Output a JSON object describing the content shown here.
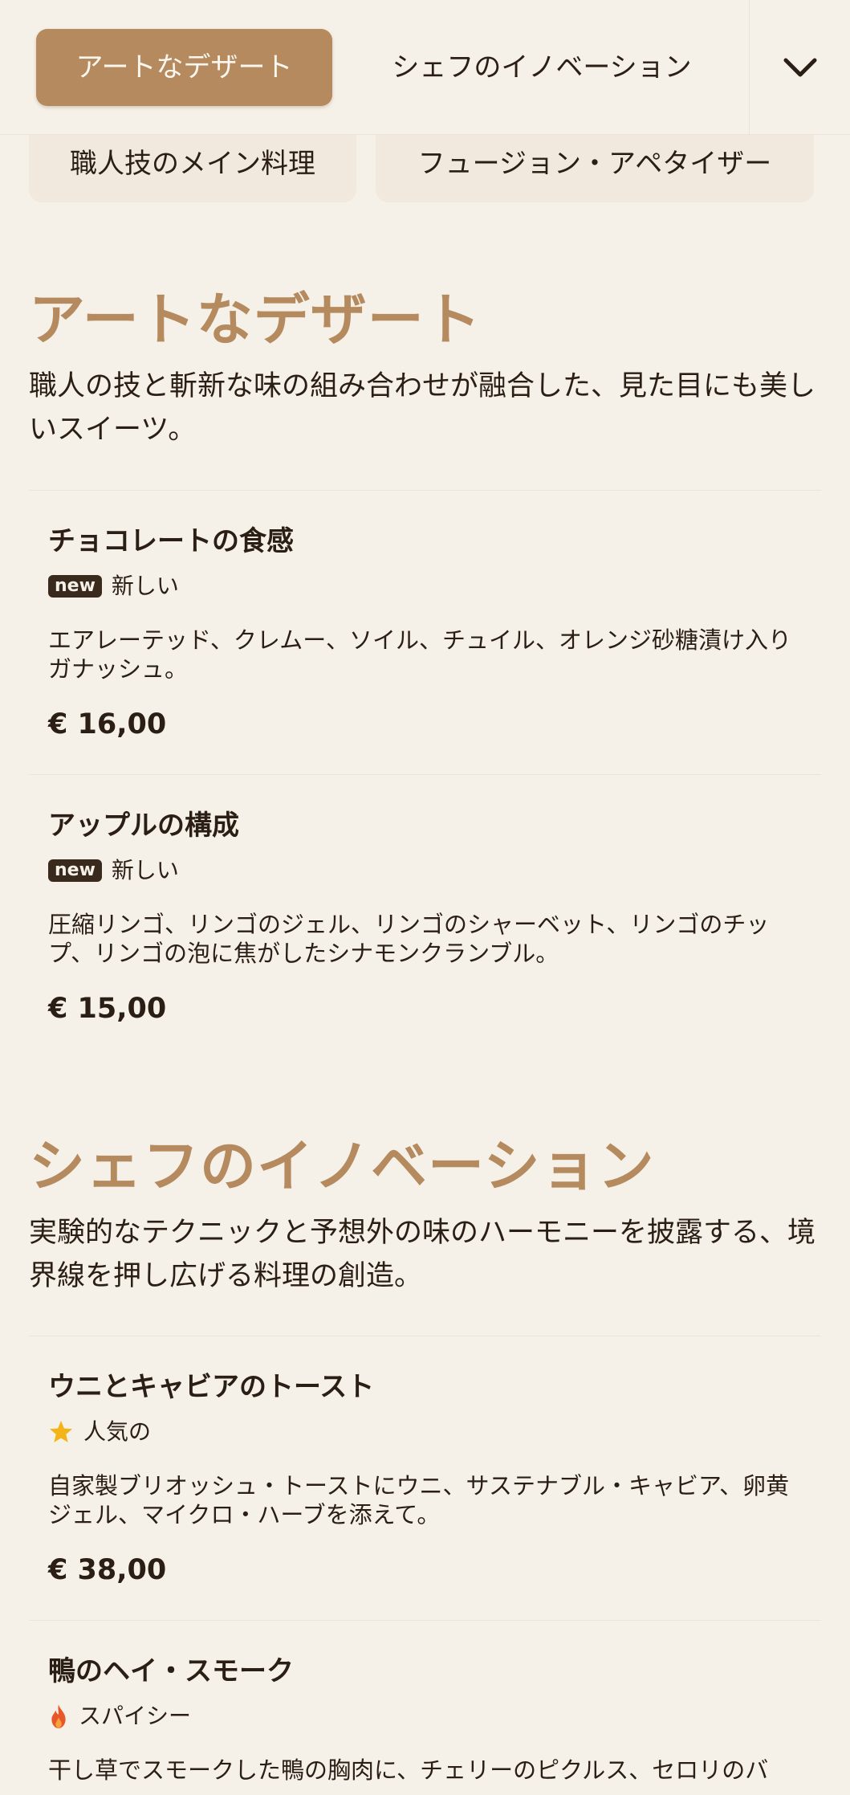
{
  "tabs": {
    "active": "アートなデザート",
    "next": "シェフのイノベーション",
    "toggle_icon": "chevron-down-icon"
  },
  "more_categories": [
    "職人技のメイン料理",
    "フュージョン・アペタイザー"
  ],
  "sections": [
    {
      "title": "アートなデザート",
      "description": "職人の技と斬新な味の組み合わせが融合した、見た目にも美しいスイーツ。",
      "items": [
        {
          "name": "チョコレートの食感",
          "badge": "new",
          "tag": "新しい",
          "description": "エアレーテッド、クレムー、ソイル、チュイル、オレンジ砂糖漬け入りガナッシュ。",
          "price": "€ 16,00"
        },
        {
          "name": "アップルの構成",
          "badge": "new",
          "tag": "新しい",
          "description": "圧縮リンゴ、リンゴのジェル、リンゴのシャーベット、リンゴのチップ、リンゴの泡に焦がしたシナモンクランブル。",
          "price": "€ 15,00"
        }
      ]
    },
    {
      "title": "シェフのイノベーション",
      "description": "実験的なテクニックと予想外の味のハーモニーを披露する、境界線を押し広げる料理の創造。",
      "items": [
        {
          "name": "ウニとキャビアのトースト",
          "icon": "star-icon",
          "tag": "人気の",
          "description": "自家製ブリオッシュ・トーストにウニ、サステナブル・キャビア、卵黄ジェル、マイクロ・ハーブを添えて。",
          "price": "€ 38,00"
        },
        {
          "name": "鴨のヘイ・スモーク",
          "icon": "flame-icon",
          "tag": "スパイシー",
          "description": "干し草でスモークした鴨の胸肉に、チェリーのピクルス、セロリのバ"
        }
      ]
    }
  ],
  "colors": {
    "background": "#f6f1e8",
    "accent": "#b48a5e",
    "text": "#2b1f15",
    "star": "#f2b418",
    "flame": "#e8572a"
  }
}
